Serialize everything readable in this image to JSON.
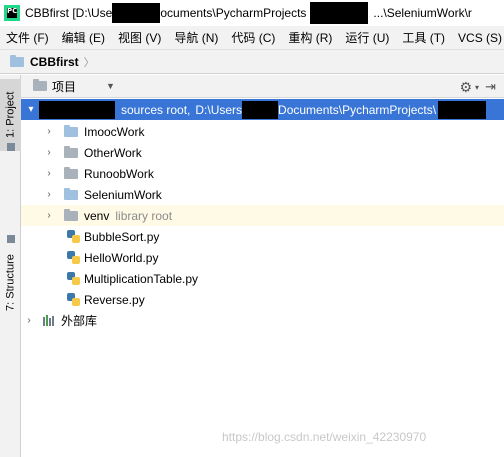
{
  "window": {
    "title_part1": "CBBfirst [D:\\Use",
    "title_part2": "ocuments\\PycharmProjects",
    "title_part3": "...\\SeleniumWork\\r"
  },
  "menu": [
    "文件 (F)",
    "编辑 (E)",
    "视图 (V)",
    "导航 (N)",
    "代码 (C)",
    "重构 (R)",
    "运行 (U)",
    "工具 (T)",
    "VCS (S)"
  ],
  "nav": {
    "crumb": "CBBfirst"
  },
  "side_tabs": {
    "project": "1: Project",
    "structure": "7: Structure"
  },
  "panel": {
    "title": "项目"
  },
  "tree": {
    "root": {
      "suffix": "sources root,",
      "path1": "D:\\Users",
      "path2": "Documents\\PycharmProjects\\"
    },
    "folders": [
      {
        "name": "ImoocWork",
        "kind": "blue"
      },
      {
        "name": "OtherWork",
        "kind": "gray"
      },
      {
        "name": "RunoobWork",
        "kind": "gray"
      },
      {
        "name": "SeleniumWork",
        "kind": "blue"
      }
    ],
    "venv": {
      "name": "venv",
      "note": "library root"
    },
    "files": [
      "BubbleSort.py",
      "HelloWorld.py",
      "MultiplicationTable.py",
      "Reverse.py"
    ],
    "external": "外部库"
  },
  "watermark": "https://blog.csdn.net/weixin_42230970"
}
